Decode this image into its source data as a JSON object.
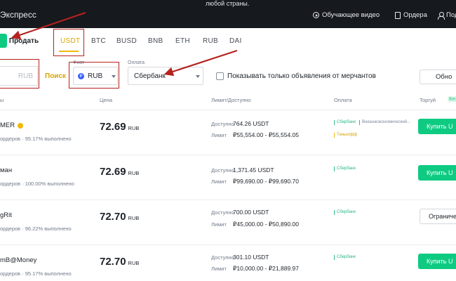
{
  "header": {
    "brand_fragment": "Экспресс",
    "top_fragment": "любой страны.",
    "tutorial_label": "Обучающее видео",
    "orders_label": "Ордера",
    "profile_label": "Под"
  },
  "trade_tabs": {
    "buy_label": "",
    "sell_label": "Продать",
    "coins": [
      "USDT",
      "BTC",
      "BUSD",
      "BNB",
      "ETH",
      "RUB",
      "DAI"
    ],
    "active_coin": "USDT"
  },
  "filters": {
    "amount_currency": "RUB",
    "search_label": "Поиск",
    "fiat_label": "Фиат",
    "fiat_value": "RUB",
    "payment_label": "Оплата",
    "payment_value": "Сбербанк",
    "merchant_only_label": "Показывать только объявления от мерчантов",
    "merchant_only_checked": false,
    "refresh_label": "Обно"
  },
  "table": {
    "headers": {
      "advertiser": "ы",
      "price": "Цена",
      "limit": "Лимит/Доступно",
      "payment": "Оплата",
      "trade": "Торгуй",
      "fee_badge": "Без"
    },
    "available_label": "Доступно",
    "limit_label": "Лимит",
    "rows": [
      {
        "name": "MER",
        "verified": true,
        "stats": "ордеров · 95.17% выполнено",
        "price": "72.69",
        "currency": "RUB",
        "available": "764.26 USDT",
        "limit": "₽55,554.00 - ₽55,554.05",
        "payments": [
          "Сбербанк",
          "Внешнеэкономический...",
          "Тинькофф"
        ],
        "action": "Купить U"
      },
      {
        "name": "ман",
        "verified": false,
        "stats": "ордеров · 100.00% выполнено",
        "price": "72.69",
        "currency": "RUB",
        "available": "1,371.45 USDT",
        "limit": "₽99,690.00 - ₽99,690.70",
        "payments": [
          "Сбербанк"
        ],
        "action": "Купить U"
      },
      {
        "name": "gRit",
        "verified": false,
        "stats": "ордеров · 96.22% выполнено",
        "price": "72.70",
        "currency": "RUB",
        "available": "700.00 USDT",
        "limit": "₽45,000.00 - ₽50,890.00",
        "payments": [
          "Сбербанк"
        ],
        "action": "Ограничен"
      },
      {
        "name": "mB@Money",
        "verified": false,
        "stats": "ордеров · 95.17% выполнено",
        "price": "72.70",
        "currency": "RUB",
        "available": "301.10 USDT",
        "limit": "₽10,000.00 - ₽21,889.97",
        "payments": [
          "Сбербанк"
        ],
        "action": "Купить U"
      }
    ]
  },
  "colors": {
    "accent_green": "#0ecb81",
    "accent_yellow": "#f0b90b",
    "annotation_red": "#b4231f",
    "header_bg": "#16191d"
  }
}
